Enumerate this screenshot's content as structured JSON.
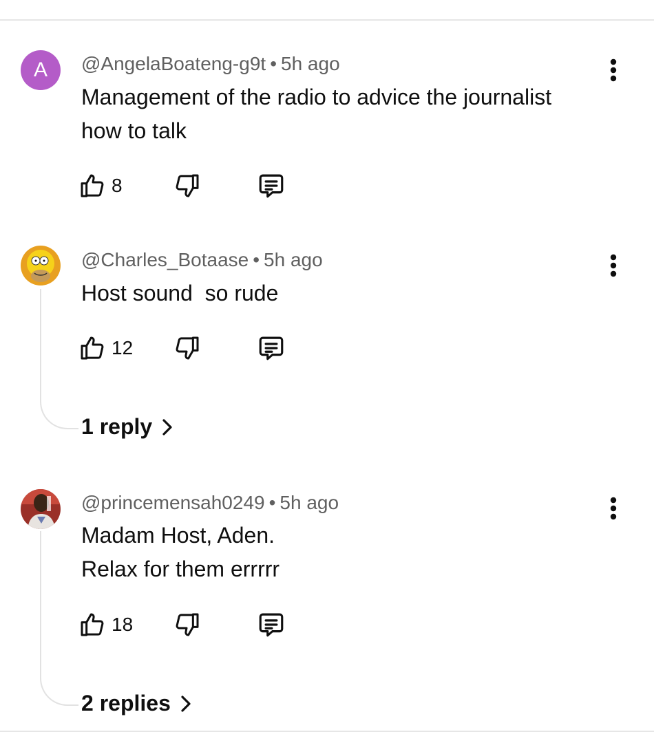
{
  "comments": [
    {
      "author": "@AngelaBoateng-g9t",
      "separator": "•",
      "time": "5h ago",
      "text": "Management of the radio to advice the journalist\nhow to talk",
      "likes": "8",
      "avatar_letter": "A",
      "avatar_color": "#b45cc8"
    },
    {
      "author": "@Charles_Botaase",
      "separator": "•",
      "time": "5h ago",
      "text": "Host sound  so rude",
      "likes": "12",
      "replies": "1 reply"
    },
    {
      "author": "@princemensah0249",
      "separator": "•",
      "time": "5h ago",
      "text": "Madam Host, Aden.\nRelax for them errrrr",
      "likes": "18",
      "replies": "2 replies"
    }
  ],
  "icons": {
    "like": "thumbs-up-icon",
    "dislike": "thumbs-down-icon",
    "reply": "comment-reply-icon",
    "more": "more-vertical-icon",
    "chevron": "chevron-right-icon"
  }
}
